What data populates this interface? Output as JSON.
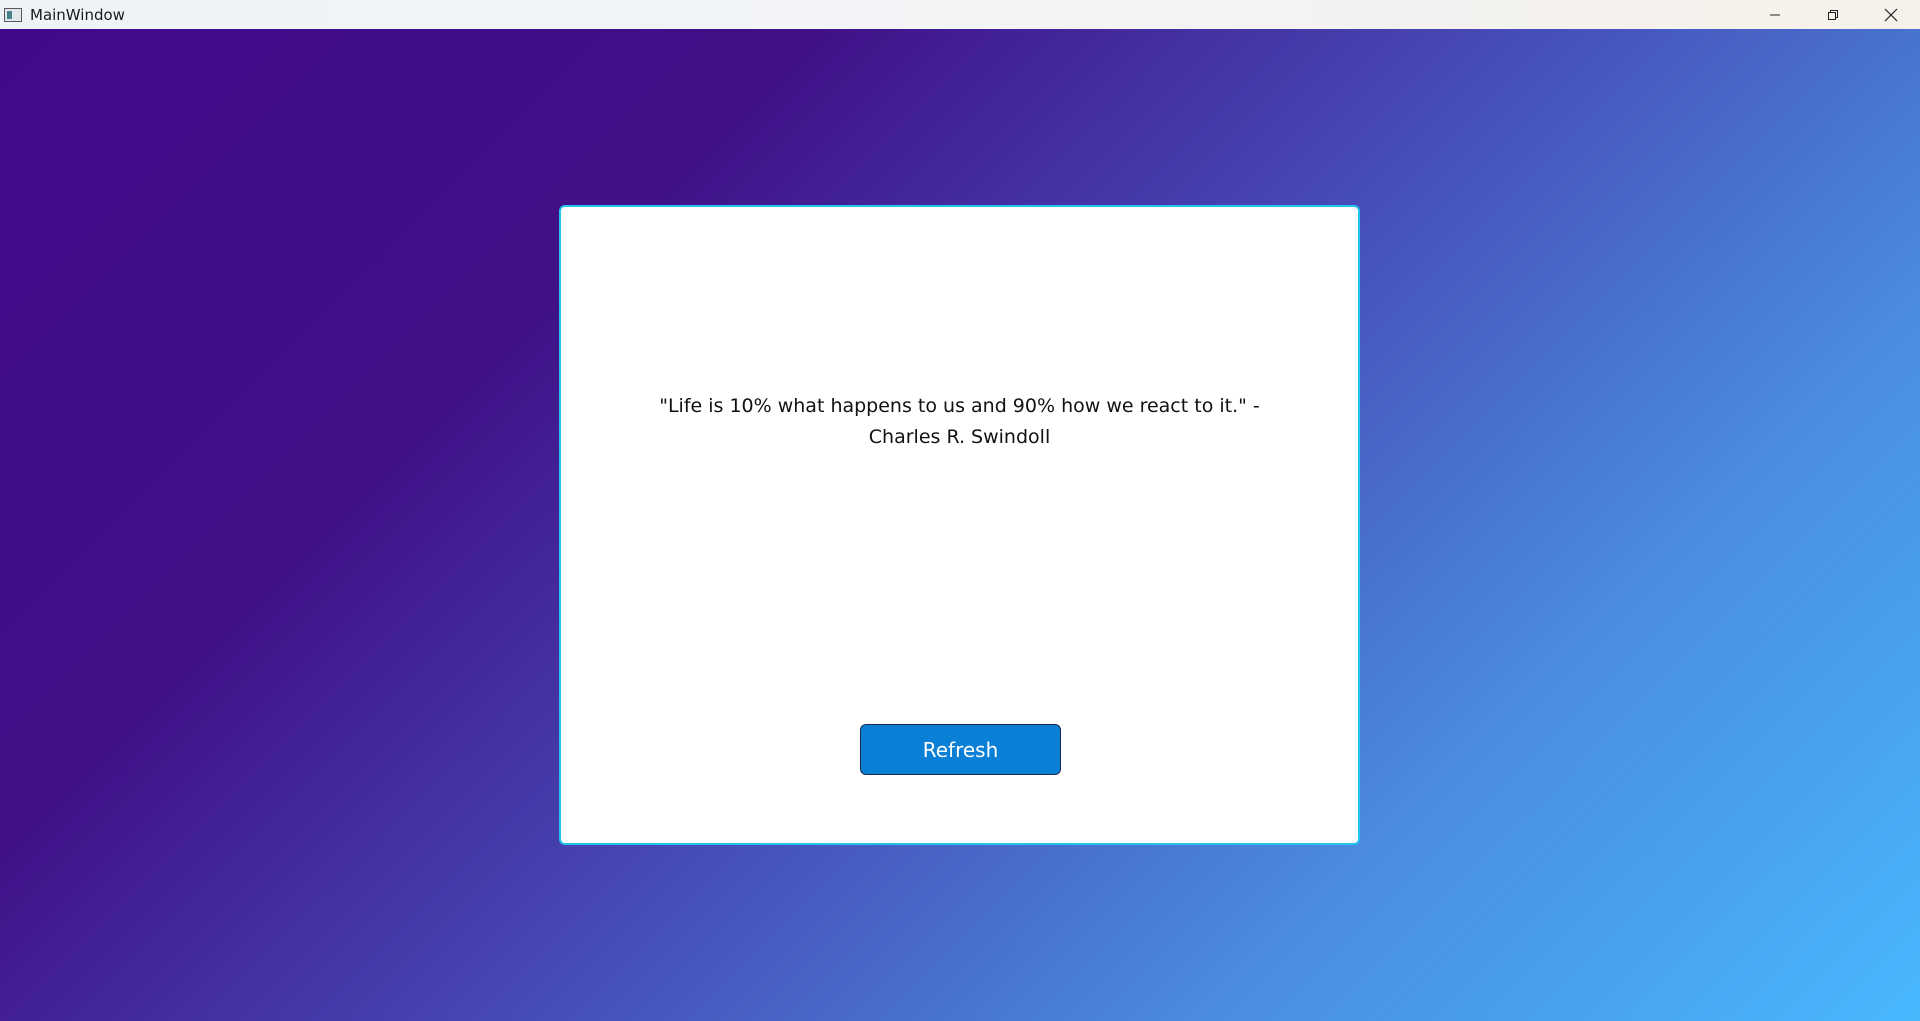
{
  "window": {
    "title": "MainWindow",
    "icons": {
      "app": "app-icon",
      "minimize": "minimize-icon",
      "restore": "restore-icon",
      "close": "close-icon"
    }
  },
  "card": {
    "quote": "\"Life is 10% what happens to us and 90% how we react to it.\" - Charles R. Swindoll",
    "refresh_label": "Refresh"
  },
  "colors": {
    "gradient_start": "#410a8c",
    "gradient_end": "#48b8ff",
    "card_border": "#24c3ef",
    "button_bg": "#0a7fd6"
  }
}
